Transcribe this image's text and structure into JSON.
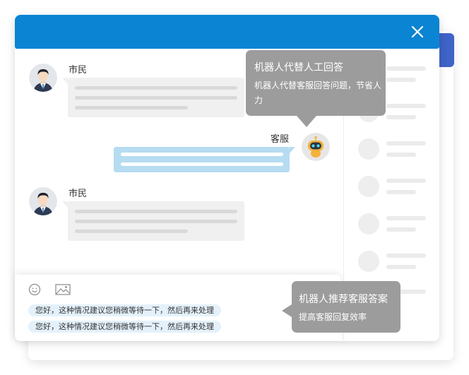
{
  "chat": {
    "messages": [
      {
        "sender": "市民",
        "role": "citizen"
      },
      {
        "sender": "客服",
        "role": "agent"
      },
      {
        "sender": "市民",
        "role": "citizen"
      }
    ]
  },
  "tooltips": {
    "robot_replace": {
      "title": "机器人代替人工回答",
      "desc": "机器人代替客服回答问题，节省人力"
    },
    "robot_recommend": {
      "title": "机器人推荐客服答案",
      "desc": "提高客服回复效率"
    }
  },
  "input": {
    "suggestions": [
      "您好，这种情况建议您稍微等待一下，然后再来处理",
      "您好，这种情况建议您稍微等待一下，然后再来处理"
    ]
  },
  "icons": {
    "close": "close-icon",
    "emoji": "emoji-icon",
    "image": "image-icon"
  },
  "colors": {
    "header": "#0b84d4",
    "accent_card": "#3f64c7",
    "agent_bubble": "#b6dcf2",
    "citizen_bubble": "#f0f0f0",
    "tooltip": "#9c9c9c",
    "suggestion_bg": "#e4f1fb"
  }
}
